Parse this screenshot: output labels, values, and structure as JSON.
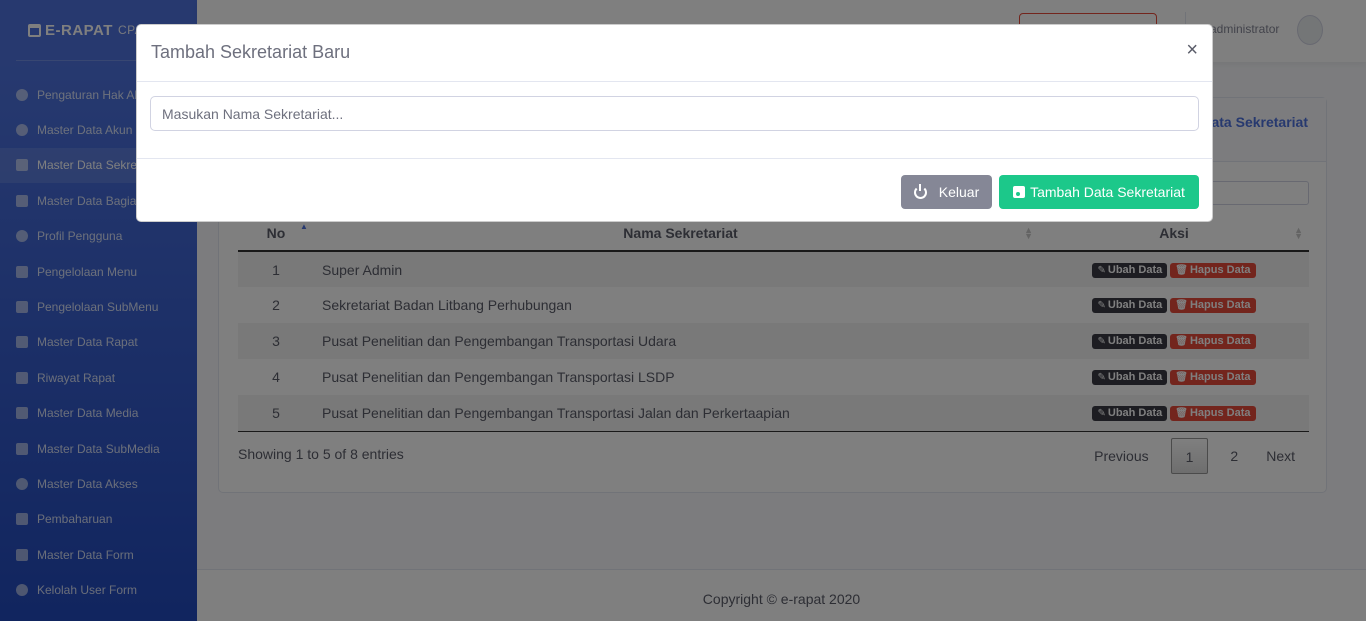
{
  "brand": {
    "name": "E-RAPAT",
    "sub": "CPA"
  },
  "sidebar": {
    "items": [
      {
        "label": "Pengaturan Hak Akses",
        "icon": "user-icon"
      },
      {
        "label": "Master Data Akun",
        "icon": "users-icon"
      },
      {
        "label": "Master Data Sekretariat",
        "icon": "sitemap-icon",
        "active": true
      },
      {
        "label": "Master Data Bagian",
        "icon": "hierarchy-icon"
      },
      {
        "label": "Profil Pengguna",
        "icon": "user-icon"
      },
      {
        "label": "Pengelolaan Menu",
        "icon": "bars-icon"
      },
      {
        "label": "Pengelolaan SubMenu",
        "icon": "list-icon"
      },
      {
        "label": "Master Data Rapat",
        "icon": "calendar-icon"
      },
      {
        "label": "Riwayat Rapat",
        "icon": "edit-icon"
      },
      {
        "label": "Master Data Media",
        "icon": "phone-icon"
      },
      {
        "label": "Master Data SubMedia",
        "icon": "phone-icon"
      },
      {
        "label": "Master Data Akses",
        "icon": "user-circle-icon"
      },
      {
        "label": "Pembaharuan",
        "icon": "sync-icon"
      },
      {
        "label": "Master Data Form",
        "icon": "file-icon"
      },
      {
        "label": "Kelolah User Form",
        "icon": "user-circle-icon"
      }
    ]
  },
  "topbar": {
    "user_name": "administrator"
  },
  "card": {
    "title": "Data Sekretariat",
    "title_visible": "ata Sekretariat"
  },
  "table": {
    "headers": {
      "no": "No",
      "name": "Nama Sekretariat",
      "aksi": "Aksi"
    },
    "rows": [
      {
        "no": "1",
        "name": "Super Admin"
      },
      {
        "no": "2",
        "name": "Sekretariat Badan Litbang Perhubungan"
      },
      {
        "no": "3",
        "name": "Pusat Penelitian dan Pengembangan Transportasi Udara"
      },
      {
        "no": "4",
        "name": "Pusat Penelitian dan Pengembangan Transportasi LSDP"
      },
      {
        "no": "5",
        "name": "Pusat Penelitian dan Pengembangan Transportasi Jalan dan Perkertaapian"
      }
    ],
    "edit_label": "Ubah Data",
    "delete_label": "Hapus Data",
    "info": "Showing 1 to 5 of 8 entries",
    "pagination": {
      "previous": "Previous",
      "pages": [
        "1",
        "2"
      ],
      "current": "1",
      "next": "Next"
    }
  },
  "footer": {
    "copyright": "Copyright © e-rapat 2020"
  },
  "modal": {
    "title": "Tambah Sekretariat Baru",
    "close": "×",
    "input_placeholder": "Masukan Nama Sekretariat...",
    "input_value": "",
    "cancel_label": "Keluar",
    "submit_label": "Tambah Data Sekretariat"
  },
  "colors": {
    "primary": "#4e73df",
    "success": "#1cc88a",
    "secondary": "#858796",
    "danger": "#e74a3b",
    "dark": "#3a3b45"
  }
}
